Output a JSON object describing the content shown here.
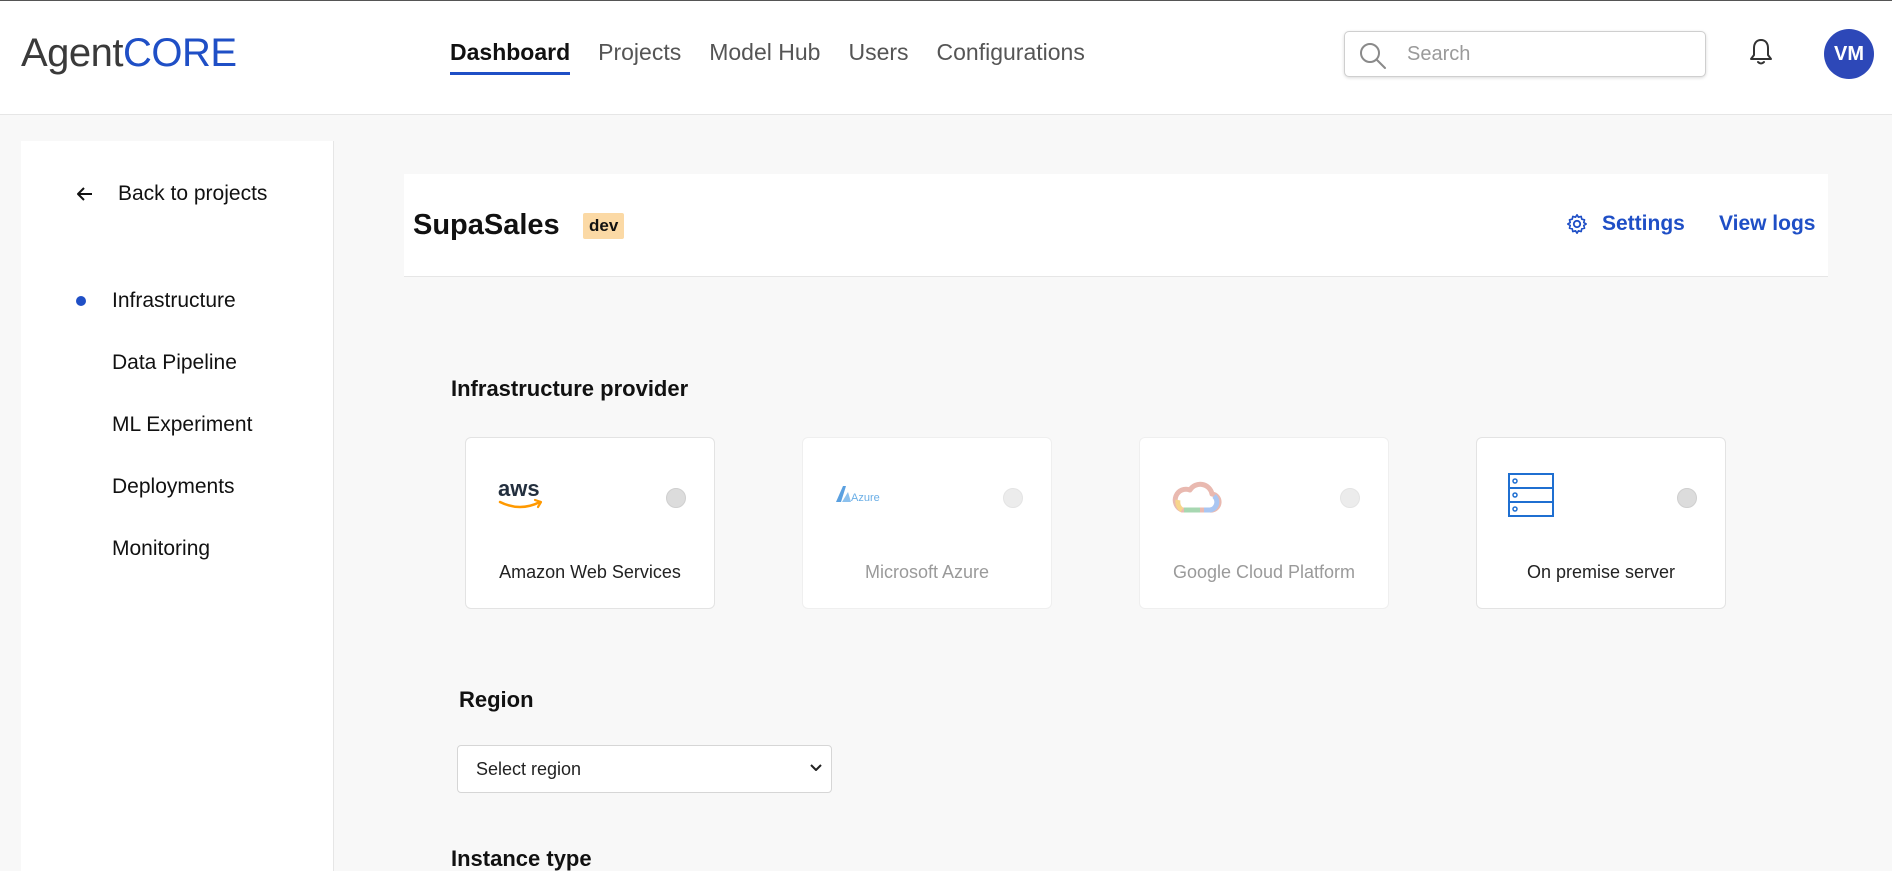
{
  "app": {
    "logo_part1": "Agent",
    "logo_part2": "CORE"
  },
  "nav": {
    "items": [
      "Dashboard",
      "Projects",
      "Model Hub",
      "Users",
      "Configurations"
    ],
    "active": "Dashboard"
  },
  "search": {
    "placeholder": "Search"
  },
  "user": {
    "initials": "VM"
  },
  "sidebar": {
    "back_label": "Back to projects",
    "items": [
      {
        "label": "Infrastructure",
        "active": true
      },
      {
        "label": "Data Pipeline",
        "active": false
      },
      {
        "label": "ML Experiment",
        "active": false
      },
      {
        "label": "Deployments",
        "active": false
      },
      {
        "label": "Monitoring",
        "active": false
      }
    ]
  },
  "project": {
    "name": "SupaSales",
    "env_badge": "dev",
    "settings_label": "Settings",
    "logs_label": "View logs"
  },
  "infrastructure": {
    "section_title": "Infrastructure provider",
    "providers": [
      {
        "name": "Amazon Web Services",
        "logo_text": "aws",
        "icon": "aws-logo-icon",
        "disabled": false
      },
      {
        "name": "Microsoft Azure",
        "logo_text": "Azure",
        "icon": "azure-logo-icon",
        "disabled": true
      },
      {
        "name": "Google Cloud Platform",
        "logo_text": "",
        "icon": "gcp-cloud-icon",
        "disabled": true
      },
      {
        "name": "On premise server",
        "logo_text": "",
        "icon": "server-rack-icon",
        "disabled": false
      }
    ]
  },
  "region": {
    "section_title": "Region",
    "select_value": "Select region"
  },
  "instance": {
    "section_title": "Instance type"
  },
  "colors": {
    "accent": "#1f4fc6",
    "badge_bg": "#fbd9a5",
    "avatar_bg": "#2d48b8"
  }
}
